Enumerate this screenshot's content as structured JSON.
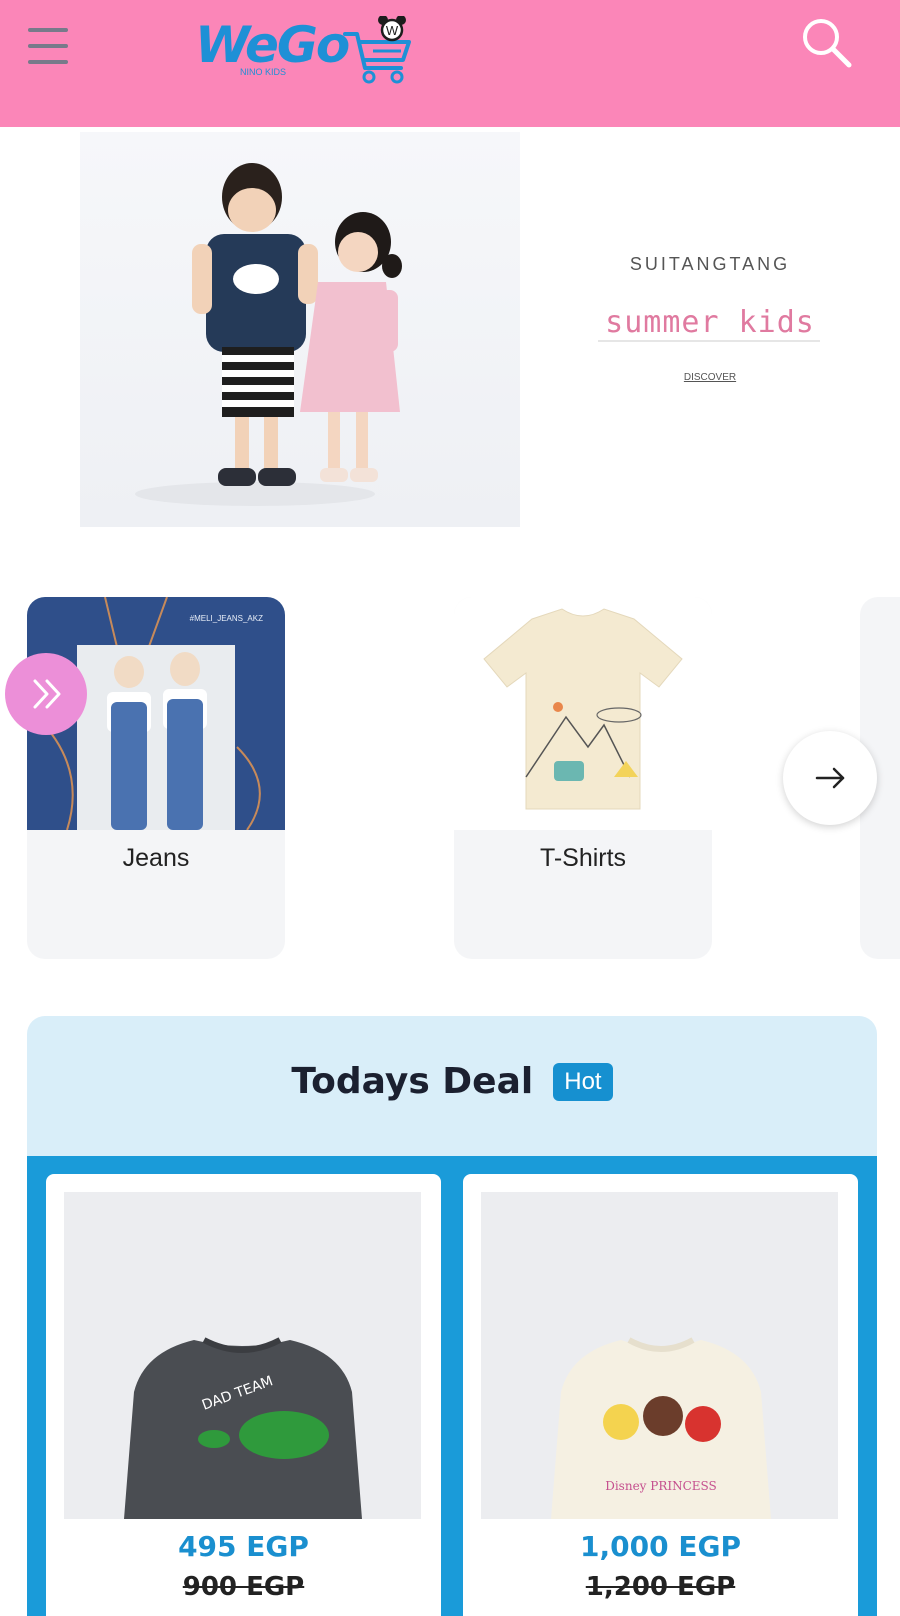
{
  "header": {
    "logo_text": "WeGo",
    "logo_subtext": "NINO KIDS",
    "logo_badge": "W",
    "background": "#fb86b8",
    "logo_color": "#1e90d6"
  },
  "hero": {
    "brand": "SUITANGTANG",
    "headline": "summer kids",
    "cta": "DISCOVER",
    "tee_print": "cloud"
  },
  "categories": {
    "items": [
      {
        "label": "Jeans",
        "tag": "#MELI_JEANS_AKZ"
      },
      {
        "label": "T-Shirts"
      }
    ],
    "accent_circle": "#ec8fd8"
  },
  "deal": {
    "title": "Todays Deal",
    "badge": "Hot",
    "band_color": "#1a9bd9",
    "products": [
      {
        "price": "495 EGP",
        "old_price": "900 EGP",
        "print": "DAD TEAM",
        "color": "#4a4d52"
      },
      {
        "price": "1,000 EGP",
        "old_price": "1,200 EGP",
        "print": "Disney PRINCESS",
        "color": "#f5f0e2"
      }
    ]
  }
}
